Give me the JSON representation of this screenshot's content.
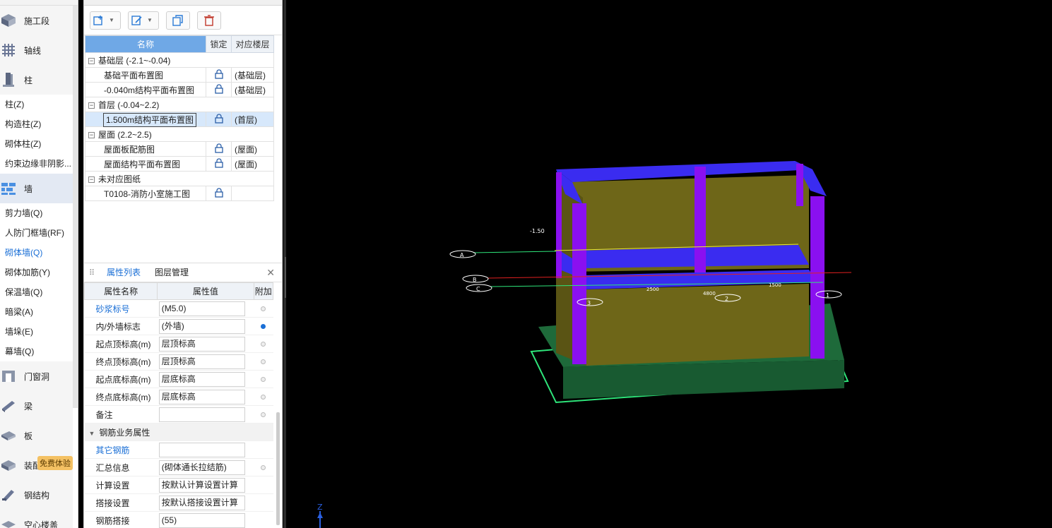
{
  "nav": {
    "categories": [
      {
        "label": "施工段",
        "icon": "cube-icon"
      },
      {
        "label": "轴线",
        "icon": "grid-icon"
      },
      {
        "label": "柱",
        "icon": "column-icon"
      }
    ],
    "column_items": [
      "柱(Z)",
      "构造柱(Z)",
      "砌体柱(Z)",
      "约束边缘非阴影..."
    ],
    "wall_category": {
      "label": "墙",
      "icon": "wall-icon"
    },
    "wall_items": [
      "剪力墙(Q)",
      "人防门框墙(RF)",
      "砌体墙(Q)",
      "砌体加筋(Y)",
      "保温墙(Q)",
      "暗梁(A)",
      "墙垛(E)",
      "幕墙(Q)"
    ],
    "active_wall_item": "砌体墙(Q)",
    "more_categories": [
      {
        "label": "门窗洞",
        "icon": "door-icon"
      },
      {
        "label": "梁",
        "icon": "beam-icon"
      },
      {
        "label": "板",
        "icon": "slab-icon"
      },
      {
        "label": "装配式",
        "icon": "prefab-icon"
      },
      {
        "label": "钢结构",
        "icon": "steel-icon"
      },
      {
        "label": "空心楼盖",
        "icon": "hollow-icon"
      }
    ],
    "badge": "免费体验"
  },
  "drawings": {
    "headers": {
      "name": "名称",
      "lock": "锁定",
      "floor": "对应楼层"
    },
    "groups": [
      {
        "label": "基础层 (-2.1~-0.04)",
        "items": [
          {
            "name": "基础平面布置图",
            "floor": "(基础层)"
          },
          {
            "name": "-0.040m结构平面布置图",
            "floor": "(基础层)"
          }
        ]
      },
      {
        "label": "首层 (-0.04~2.2)",
        "items": [
          {
            "name": "1.500m结构平面布置图",
            "floor": "(首层)"
          }
        ]
      },
      {
        "label": "屋面 (2.2~2.5)",
        "items": [
          {
            "name": "屋面板配筋图",
            "floor": "(屋面)"
          },
          {
            "name": "屋面结构平面布置图",
            "floor": "(屋面)"
          }
        ]
      },
      {
        "label": "未对应图纸",
        "items": [
          {
            "name": "T0108-消防小室施工图",
            "floor": ""
          }
        ]
      }
    ]
  },
  "props": {
    "tabs": [
      "属性列表",
      "图层管理"
    ],
    "headers": {
      "name": "属性名称",
      "value": "属性值",
      "extra": "附加"
    },
    "rows": [
      {
        "name": "砂浆标号",
        "value": "(M5.0)"
      },
      {
        "name": "内/外墙标志",
        "value": "(外墙)"
      },
      {
        "name": "起点顶标高(m)",
        "value": "层顶标高"
      },
      {
        "name": "终点顶标高(m)",
        "value": "层顶标高"
      },
      {
        "name": "起点底标高(m)",
        "value": "层底标高"
      },
      {
        "name": "终点底标高(m)",
        "value": "层底标高"
      },
      {
        "name": "备注",
        "value": ""
      }
    ],
    "group": "钢筋业务属性",
    "rows2": [
      {
        "name": "其它钢筋",
        "value": ""
      },
      {
        "name": "汇总信息",
        "value": "(砌体通长拉结筋)"
      },
      {
        "name": "计算设置",
        "value": "按默认计算设置计算"
      },
      {
        "name": "搭接设置",
        "value": "按默认搭接设置计算"
      },
      {
        "name": "钢筋搭接",
        "value": "(55)"
      }
    ]
  },
  "viewport": {
    "axis_z": "Z",
    "axis_bubbles": [
      "A",
      "B",
      "C",
      "1",
      "2",
      "3"
    ],
    "dims": [
      "1500",
      "2500",
      "4800"
    ],
    "elev_label": "-1.50",
    "colors": {
      "wall": "#6e6618",
      "beam": "#3a2cf0",
      "column": "#8a10f0",
      "foundation": "#1e6a3a",
      "edge": "#2ee57a"
    }
  }
}
